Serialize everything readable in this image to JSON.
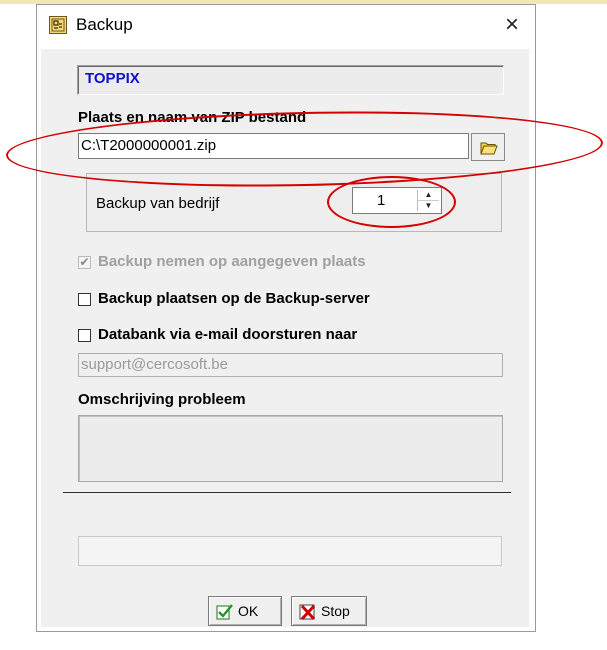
{
  "window": {
    "title": "Backup",
    "close_glyph": "×"
  },
  "company_name": "TOPPIX",
  "zip": {
    "label": "Plaats en naam van ZIP bestand",
    "value": "C:\\T2000000001.zip"
  },
  "company_group": {
    "label": "Backup van bedrijf",
    "spinner_value": "1"
  },
  "options": [
    {
      "label": "Backup nemen op aangegeven plaats",
      "checked": true,
      "enabled": false
    },
    {
      "label": "Backup plaatsen op de Backup-server",
      "checked": false,
      "enabled": true
    },
    {
      "label": "Databank via e-mail doorsturen naar",
      "checked": false,
      "enabled": true
    }
  ],
  "email": {
    "value": "support@cercosoft.be"
  },
  "description": {
    "label": "Omschrijving probleem",
    "value": ""
  },
  "buttons": {
    "ok_label": "OK",
    "stop_label": "Stop"
  },
  "colors": {
    "company_text": "#1010d0",
    "annotation": "#d40000",
    "dialog_bg": "#f0f0f0"
  },
  "icons": {
    "app": "backup-app-icon",
    "folder": "folder-open-icon",
    "ok": "check-icon",
    "stop": "red-x-icon"
  }
}
